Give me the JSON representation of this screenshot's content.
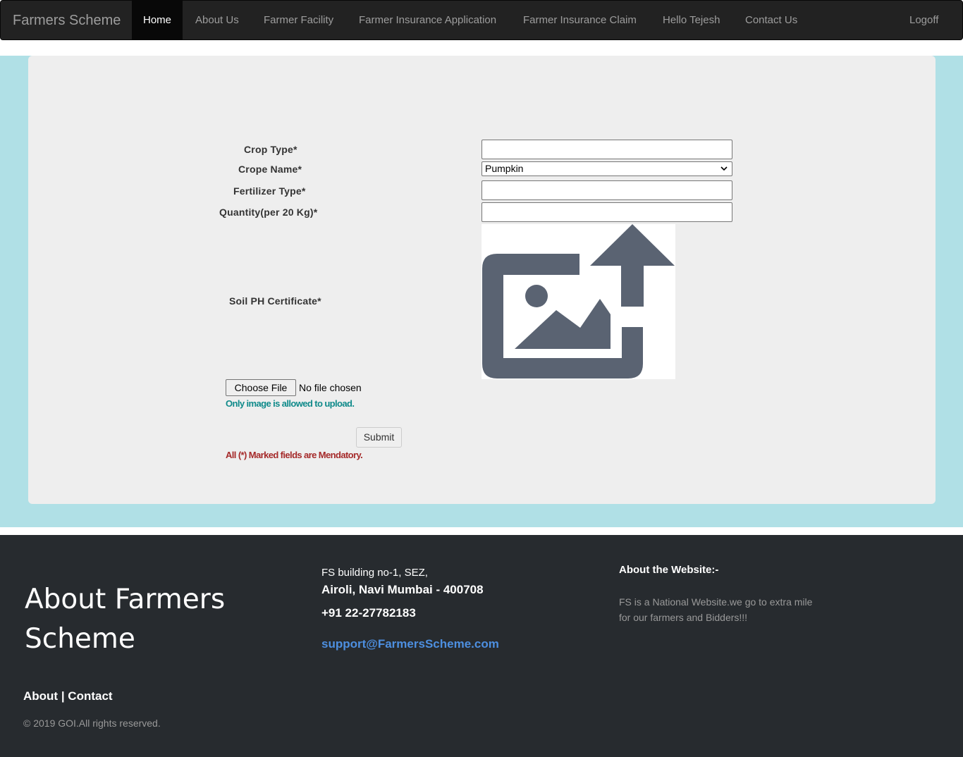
{
  "navbar": {
    "brand": "Farmers Scheme",
    "items": [
      {
        "label": "Home",
        "active": true
      },
      {
        "label": "About Us"
      },
      {
        "label": "Farmer Facility"
      },
      {
        "label": "Farmer Insurance Application"
      },
      {
        "label": "Farmer Insurance Claim"
      },
      {
        "label": "Hello Tejesh"
      },
      {
        "label": "Contact Us"
      }
    ],
    "logoff": "Logoff"
  },
  "form": {
    "crop_type_label": "Crop Type*",
    "crop_type_value": "",
    "crop_name_label": "Crope Name*",
    "crop_name_selected": "Pumpkin",
    "fertilizer_label": "Fertilizer Type*",
    "fertilizer_value": "",
    "quantity_label": "Quantity(per 20 Kg)*",
    "quantity_value": "",
    "soil_label": "Soil PH Certificate*",
    "file_button": "Choose File",
    "file_status": "No file chosen",
    "image_note": "Only image is allowed to upload.",
    "submit": "Submit",
    "mandatory_note": "All (*) Marked fields are Mendatory."
  },
  "footer": {
    "title": "About Farmers Scheme",
    "links": "About | Contact",
    "copyright": "© 2019 GOI.All rights reserved.",
    "address_line1": "FS building no-1, SEZ,",
    "address_line2": "Airoli, Navi Mumbai - 400708",
    "phone": "+91 22-27782183",
    "email": "support@FarmersScheme.com",
    "about_heading": "About the Website:-",
    "about_text": "FS is a National Website.we go to extra mile for our farmers and Bidders!!!"
  },
  "colors": {
    "navbar_bg": "#222222",
    "main_band": "#b0e0e6",
    "panel": "#eeeeee",
    "footer_bg": "#272b2f",
    "note_teal": "#0f8a8a",
    "note_red": "#a52a2a",
    "email_link": "#4d8fe0",
    "upload_icon": "#5a6372"
  },
  "icons": {
    "upload_image": "image-upload-icon",
    "select_arrow": "chevron-down-icon"
  }
}
